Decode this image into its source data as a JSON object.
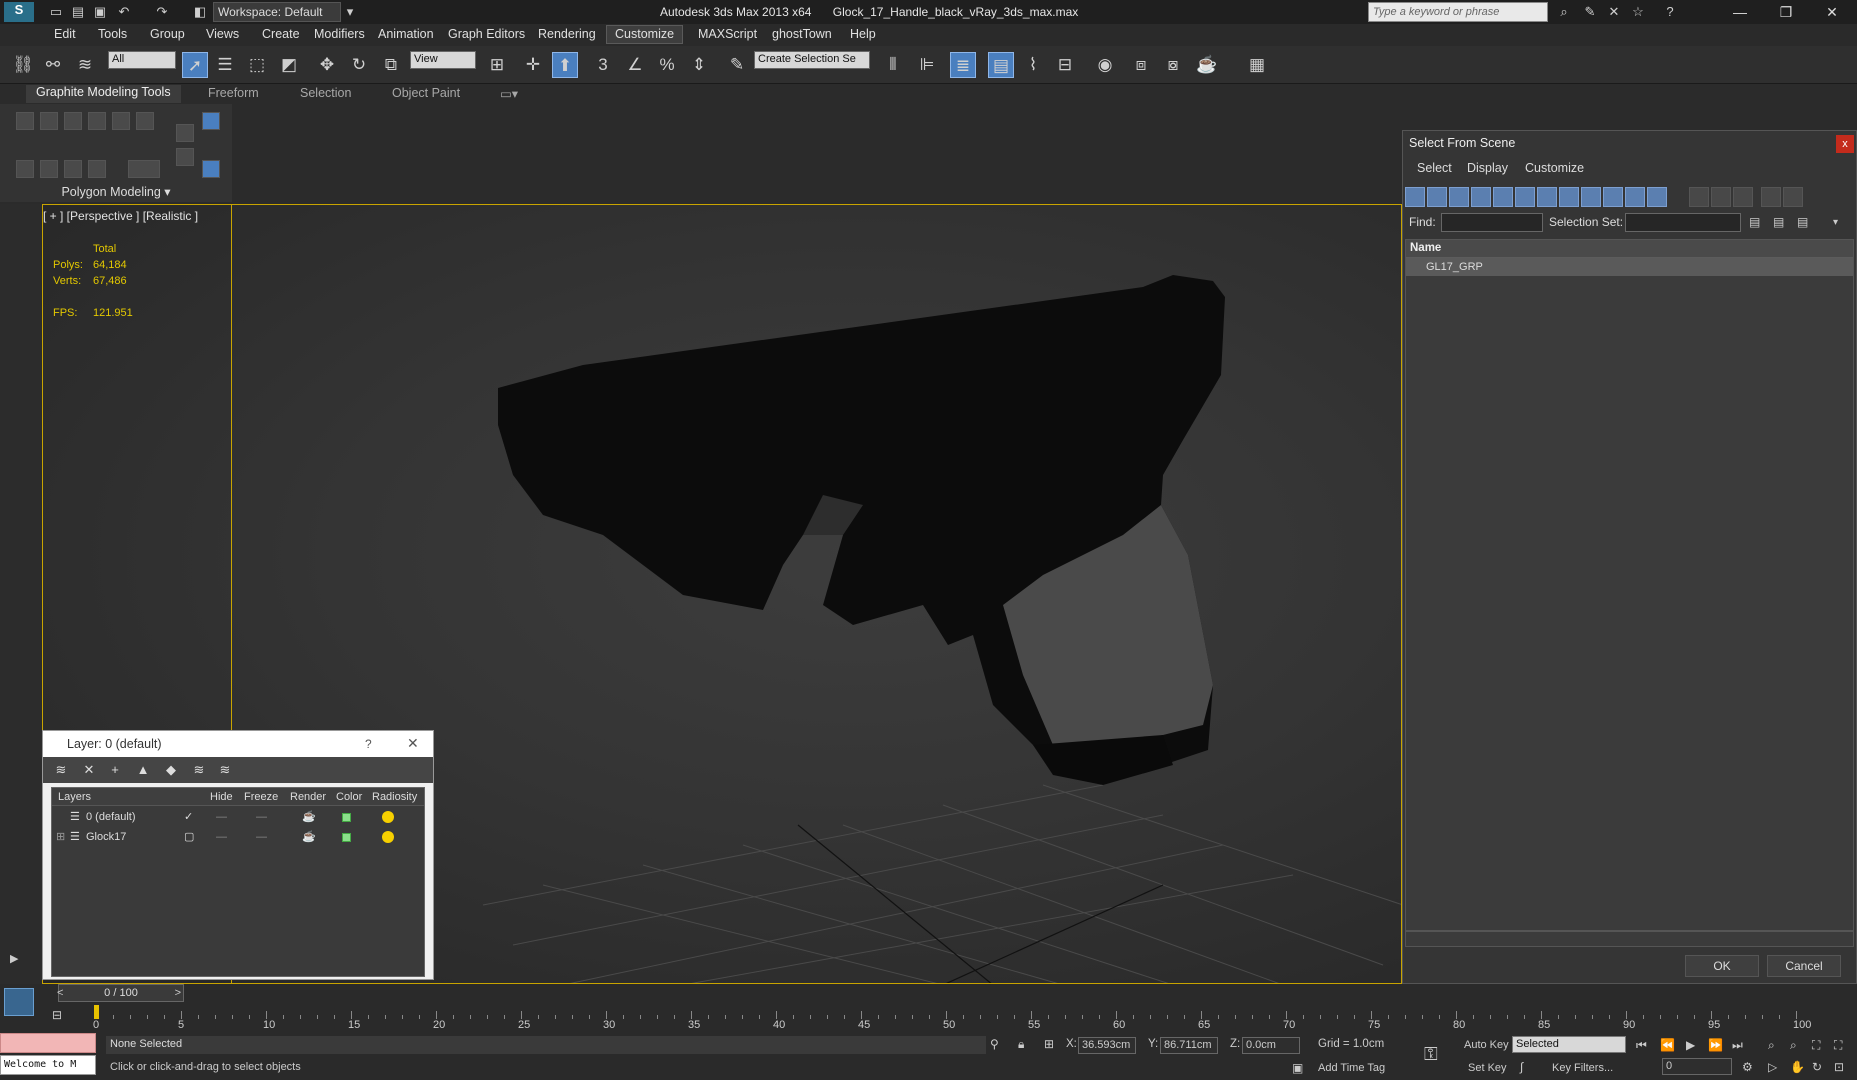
{
  "titlebar": {
    "workspace": "Workspace: Default",
    "app": "Autodesk 3ds Max  2013 x64",
    "file": "Glock_17_Handle_black_vRay_3ds_max.max",
    "search_placeholder": "Type a keyword or phrase"
  },
  "menu": [
    "Edit",
    "Tools",
    "Group",
    "Views",
    "Create",
    "Modifiers",
    "Animation",
    "Graph Editors",
    "Rendering",
    "Customize",
    "MAXScript",
    "ghostTown",
    "Help"
  ],
  "toolbar": {
    "filter": "All",
    "ref_coord": "View",
    "selection_set": "Create Selection Se"
  },
  "ribbon": {
    "tabs": [
      "Graphite Modeling Tools",
      "Freeform",
      "Selection",
      "Object Paint"
    ],
    "panel_label": "Polygon Modeling"
  },
  "viewport": {
    "label": "[ + ] [Perspective ] [Realistic ]",
    "stats_title": "Total",
    "polys_label": "Polys:",
    "polys": "64,184",
    "verts_label": "Verts:",
    "verts": "67,486",
    "fps_label": "FPS:",
    "fps": "121.951"
  },
  "select_from_scene": {
    "title": "Select From Scene",
    "menu": [
      "Select",
      "Display",
      "Customize"
    ],
    "find_label": "Find:",
    "selection_set_label": "Selection Set:",
    "column_name": "Name",
    "items": [
      "GL17_GRP"
    ],
    "ok": "OK",
    "cancel": "Cancel"
  },
  "layer_dialog": {
    "title": "Layer: 0 (default)",
    "help": "?",
    "columns": [
      "Layers",
      "Hide",
      "Freeze",
      "Render",
      "Color",
      "Radiosity"
    ],
    "rows": [
      "0 (default)",
      "Glock17"
    ]
  },
  "timeline": {
    "slider": "0 / 100",
    "ticks": [
      "0",
      "5",
      "10",
      "15",
      "20",
      "25",
      "30",
      "35",
      "40",
      "45",
      "50",
      "55",
      "60",
      "65",
      "70",
      "75",
      "80",
      "85",
      "90",
      "95",
      "100"
    ]
  },
  "status": {
    "selection": "None Selected",
    "prompt": "Click or click-and-drag to select objects",
    "welcome": "Welcome to M",
    "x_label": "X:",
    "x": "36.593cm",
    "y_label": "Y:",
    "y": "86.711cm",
    "z_label": "Z:",
    "z": "0.0cm",
    "grid": "Grid = 1.0cm",
    "add_time_tag": "Add Time Tag",
    "auto_key": "Auto Key",
    "selected": "Selected",
    "set_key": "Set Key",
    "key_filters": "Key Filters...",
    "frame": "0"
  },
  "colors": {
    "viewport_border": "#c8a400",
    "stats_text": "#e3c800",
    "active_tool": "#4a7fbf"
  }
}
